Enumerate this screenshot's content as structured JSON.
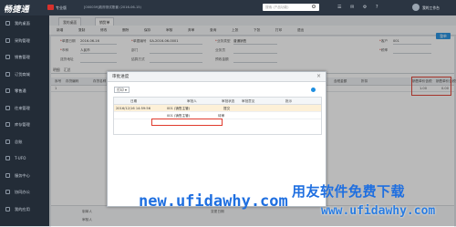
{
  "app": {
    "logo_text": "畅捷通",
    "edition": "专业版",
    "company_info": "[000039]政府测试账套   (2016-06-15)",
    "search_placeholder": "搜索 (产品功能)",
    "user_label": "我的工作台",
    "accent": "#1e8ee0",
    "sidebar_bg": "#232c37",
    "highlight_color": "#e03a2d"
  },
  "sidebar": {
    "items": [
      {
        "label": "我的桌面",
        "icon": "home-icon"
      },
      {
        "label": "采购管理",
        "icon": "cart-icon"
      },
      {
        "label": "销售管理",
        "icon": "sales-icon"
      },
      {
        "label": "订货商城",
        "icon": "store-icon"
      },
      {
        "label": "零售通",
        "icon": "retail-icon"
      },
      {
        "label": "往来管理",
        "icon": "exchange-icon"
      },
      {
        "label": "库存管理",
        "icon": "box-icon"
      },
      {
        "label": "总账",
        "icon": "ledger-icon"
      },
      {
        "label": "T-UFO",
        "icon": "report-icon"
      },
      {
        "label": "服务中心",
        "icon": "service-icon"
      },
      {
        "label": "协同办公",
        "icon": "collab-icon"
      },
      {
        "label": "我的应用",
        "icon": "apps-icon"
      }
    ]
  },
  "tabs": [
    {
      "label": "我的桌面"
    },
    {
      "label": "销货单"
    }
  ],
  "toolbar": [
    "新增",
    "复制",
    "修改",
    "删除",
    "保存",
    "审核",
    "弃审",
    "查询",
    "上张",
    "下张",
    "打印",
    "退出"
  ],
  "form": {
    "doc_date_label": "单据日期",
    "doc_date": "2016-06-16",
    "doc_no_label": "单据编号",
    "doc_no": "SA-2016-06-0001",
    "biz_type_label": "业务类型",
    "biz_type": "普通销售",
    "customer_label": "客户",
    "customer": "001",
    "currency_label": "币种",
    "currency": "人民币",
    "dept_label": "部门",
    "salesman_label": "业务员",
    "delivery_label": "送货地址",
    "contact_label": "联系人",
    "settle_label": "结算方式",
    "amount_label": "预收金额",
    "invoice_label": "发票号",
    "tax_label": "税率",
    "save_button": "整单"
  },
  "grid": {
    "subtabs": [
      "明细",
      "汇总"
    ],
    "headers": [
      "序号",
      "存货编码",
      "存货名称",
      "规格型号",
      "单位",
      "数量",
      "单价",
      "含税单价",
      "金额",
      "税率",
      "税额",
      "含税金额",
      "折扣",
      "销售单价含税",
      "销售单价含税额"
    ],
    "row": {
      "index": "1",
      "tax_amount": "1.00",
      "total": "0.00"
    }
  },
  "footer": {
    "maker_label": "制单人",
    "auditor_label": "审核人",
    "hint_label": "变更日期"
  },
  "dialog": {
    "title": "审批进度",
    "print_button": "打印",
    "headers": [
      "日期",
      "审批人",
      "审批状态",
      "审批意见",
      "批示"
    ],
    "rows": [
      {
        "date": "2016/12/16  14:59:56",
        "approver": "001 (销售主管)",
        "status": "提交",
        "opinion": "",
        "note": ""
      },
      {
        "date": "",
        "approver": "001 (销售主管)",
        "status": "待审",
        "opinion": "",
        "note": ""
      }
    ]
  },
  "watermark": {
    "cn": "用友软件免费下载",
    "url": "new.ufidawhy.com",
    "url2": "www.ufidawhy.com"
  }
}
